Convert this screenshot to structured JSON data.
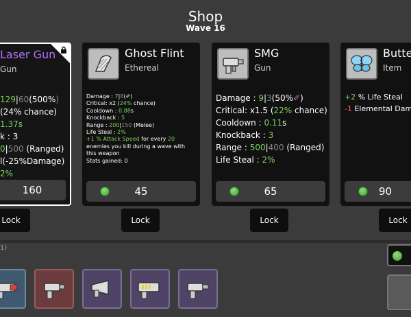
{
  "header": {
    "title": "Shop",
    "wave": "Wave 16"
  },
  "cards": [
    {
      "name": "Laser Gun",
      "type": "Gun",
      "price": "160",
      "locked": true,
      "stats": [
        {
          "a": "129",
          "b": "|",
          "c": "60",
          "d": "(500%",
          "e": ")"
        },
        {
          "a": "(24% chance)"
        },
        {
          "a": "1.37s"
        },
        {
          "a": "k : 3"
        },
        {
          "a": "0",
          "b": "|",
          "c": "500",
          "d": " (Ranged)"
        },
        {
          "a": "l(-25%Damage)"
        },
        {
          "a": "2%"
        }
      ]
    },
    {
      "name": "Ghost Flint",
      "type": "Ethereal",
      "price": "45",
      "stats": {
        "damage": "Damage : ",
        "damage_val": "7",
        "damage_sep": "|",
        "damage_base": "8",
        "damage_ico": "(",
        "critical": "Critical: x2 (",
        "critical_pct": "24%",
        "critical_tail": " chance)",
        "cooldown": "Cooldown : ",
        "cooldown_val": "0.88",
        "cooldown_unit": "s",
        "knockback": "Knockback : ",
        "knockback_val": "5",
        "range": "Range : ",
        "range_val": "200",
        "range_sep": "|",
        "range_base": "150",
        "range_tail": " (Melee)",
        "lifesteal": "Life Steal : ",
        "lifesteal_val": "2%",
        "special1a": "+1 ",
        "special1b": "% Attack Speed",
        "special1c": " for every ",
        "special1d": "20",
        "special2": "enemies you kill during a wave with",
        "special3": "this weapon",
        "gained": "Stats gained: 0"
      }
    },
    {
      "name": "SMG",
      "type": "Gun",
      "price": "65",
      "stats": {
        "damage": "Damage : ",
        "damage_val": "9",
        "damage_sep": "|",
        "damage_base": "3",
        "damage_pct": "(50%",
        "critical": "Critical: x1.5 (",
        "critical_pct": "22%",
        "critical_tail": " chance)",
        "cooldown": "Cooldown : ",
        "cooldown_val": "0.11",
        "cooldown_unit": "s",
        "knockback": "Knockback : ",
        "knockback_val": "3",
        "range": "Range : ",
        "range_val": "500",
        "range_sep": "|",
        "range_base": "400",
        "range_tail": " (Ranged)",
        "lifesteal": "Life Steal : ",
        "lifesteal_val": "2%"
      }
    },
    {
      "name": "Butte",
      "type": "Item",
      "price": "90",
      "stats": {
        "line1a": "+2",
        "line1b": " % Life Steal",
        "line2a": "-1",
        "line2b": " Elemental Dam"
      }
    }
  ],
  "lock_label": "Lock",
  "inventory_label": "1)",
  "colors": {
    "bg": "#3b3b3b",
    "card": "#111111",
    "green": "#7cd15a",
    "red": "#ff5a5a"
  }
}
